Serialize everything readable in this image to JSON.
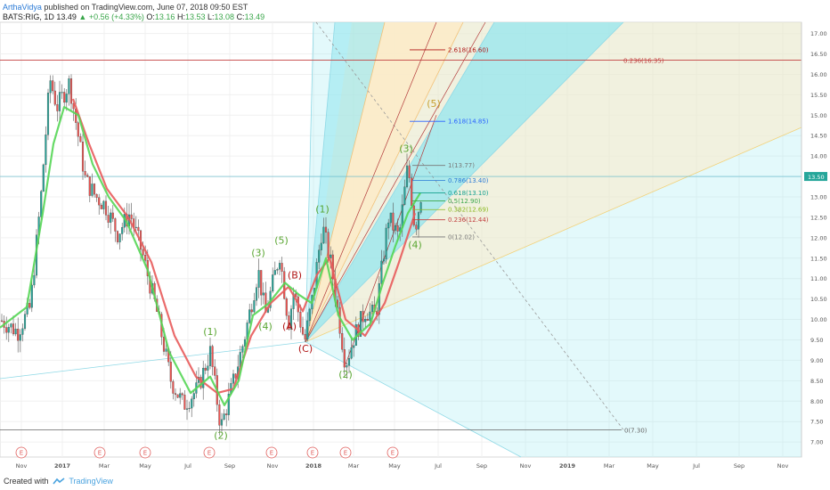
{
  "header": {
    "author": "ArthaVidya",
    "published": " published on TradingView.com, June 07, 2018 09:50 EST",
    "symbol": "BATS:RIG, 1D",
    "last": "13.49",
    "change": "▲ +0.56 (+4.33%)",
    "open_label": "O:",
    "open": "13.16",
    "high_label": "H:",
    "high": "13.53",
    "low_label": "L:",
    "low": "13.08",
    "close_label": "C:",
    "close": "13.49"
  },
  "footer": {
    "created_with": "Created with",
    "brand": "TradingView"
  },
  "colors": {
    "up": "#26a69a",
    "down": "#ef5350",
    "ma_fast": "#55d655",
    "ma_slow": "#e85b5b",
    "fan_cyan": "#8fe6ef",
    "fan_cream": "#fdebc8",
    "wave_green": "#5aa632",
    "wave_red": "#b01515",
    "price_tag": "#26a69a"
  },
  "chart_data": {
    "type": "candlestick",
    "symbol": "BATS:RIG",
    "interval": "1D",
    "ylim": [
      6.85,
      17.1
    ],
    "y_ticks": [
      "7.00",
      "7.50",
      "8.00",
      "8.50",
      "9.00",
      "9.50",
      "10.00",
      "10.50",
      "11.00",
      "11.50",
      "12.00",
      "12.50",
      "13.00",
      "13.50",
      "14.00",
      "14.50",
      "15.00",
      "15.50",
      "16.00",
      "16.50",
      "17.00"
    ],
    "x_ticks": [
      "Nov",
      "2017",
      "Mar",
      "May",
      "Jul",
      "Sep",
      "Nov",
      "2018",
      "Mar",
      "May",
      "Jul",
      "Sep",
      "Nov",
      "2019",
      "Mar",
      "May",
      "Jul",
      "Sep",
      "Nov"
    ],
    "last_price_tag": "13.50",
    "close_anchors": [
      {
        "x": 0,
        "y": 10.0
      },
      {
        "x": 20,
        "y": 9.7
      },
      {
        "x": 34,
        "y": 10.3
      },
      {
        "x": 46,
        "y": 13.0
      },
      {
        "x": 56,
        "y": 15.9
      },
      {
        "x": 64,
        "y": 15.2
      },
      {
        "x": 78,
        "y": 15.8
      },
      {
        "x": 96,
        "y": 13.4
      },
      {
        "x": 108,
        "y": 13.0
      },
      {
        "x": 118,
        "y": 12.8
      },
      {
        "x": 132,
        "y": 12.1
      },
      {
        "x": 146,
        "y": 12.6
      },
      {
        "x": 160,
        "y": 11.6
      },
      {
        "x": 176,
        "y": 10.2
      },
      {
        "x": 192,
        "y": 8.5
      },
      {
        "x": 206,
        "y": 7.9
      },
      {
        "x": 222,
        "y": 8.3
      },
      {
        "x": 236,
        "y": 9.2
      },
      {
        "x": 248,
        "y": 7.35
      },
      {
        "x": 260,
        "y": 8.3
      },
      {
        "x": 274,
        "y": 9.5
      },
      {
        "x": 290,
        "y": 11.2
      },
      {
        "x": 298,
        "y": 10.1
      },
      {
        "x": 314,
        "y": 11.6
      },
      {
        "x": 324,
        "y": 9.9
      },
      {
        "x": 330,
        "y": 10.7
      },
      {
        "x": 342,
        "y": 9.45
      },
      {
        "x": 350,
        "y": 10.4
      },
      {
        "x": 362,
        "y": 12.3
      },
      {
        "x": 372,
        "y": 11.3
      },
      {
        "x": 388,
        "y": 8.9
      },
      {
        "x": 398,
        "y": 9.6
      },
      {
        "x": 410,
        "y": 10.2
      },
      {
        "x": 422,
        "y": 10.1
      },
      {
        "x": 436,
        "y": 12.5
      },
      {
        "x": 448,
        "y": 12.0
      },
      {
        "x": 458,
        "y": 13.8
      },
      {
        "x": 466,
        "y": 12.2
      },
      {
        "x": 474,
        "y": 13.2
      }
    ],
    "ma_fast": [
      {
        "x": 0,
        "y": 9.8
      },
      {
        "x": 30,
        "y": 10.3
      },
      {
        "x": 48,
        "y": 12.6
      },
      {
        "x": 60,
        "y": 14.3
      },
      {
        "x": 72,
        "y": 15.2
      },
      {
        "x": 88,
        "y": 15.0
      },
      {
        "x": 104,
        "y": 13.8
      },
      {
        "x": 122,
        "y": 13.0
      },
      {
        "x": 142,
        "y": 12.4
      },
      {
        "x": 166,
        "y": 11.2
      },
      {
        "x": 190,
        "y": 9.2
      },
      {
        "x": 214,
        "y": 8.2
      },
      {
        "x": 236,
        "y": 8.6
      },
      {
        "x": 252,
        "y": 7.9
      },
      {
        "x": 268,
        "y": 8.5
      },
      {
        "x": 284,
        "y": 10.1
      },
      {
        "x": 302,
        "y": 10.4
      },
      {
        "x": 320,
        "y": 10.9
      },
      {
        "x": 336,
        "y": 10.6
      },
      {
        "x": 350,
        "y": 10.4
      },
      {
        "x": 366,
        "y": 11.5
      },
      {
        "x": 380,
        "y": 10.1
      },
      {
        "x": 396,
        "y": 9.5
      },
      {
        "x": 416,
        "y": 9.9
      },
      {
        "x": 430,
        "y": 10.9
      },
      {
        "x": 444,
        "y": 11.8
      },
      {
        "x": 458,
        "y": 12.6
      },
      {
        "x": 472,
        "y": 13.1
      }
    ],
    "ma_slow": [
      {
        "x": 82,
        "y": 15.4
      },
      {
        "x": 100,
        "y": 14.3
      },
      {
        "x": 120,
        "y": 13.2
      },
      {
        "x": 144,
        "y": 12.5
      },
      {
        "x": 170,
        "y": 11.4
      },
      {
        "x": 196,
        "y": 9.6
      },
      {
        "x": 220,
        "y": 8.6
      },
      {
        "x": 244,
        "y": 8.2
      },
      {
        "x": 262,
        "y": 8.3
      },
      {
        "x": 282,
        "y": 9.6
      },
      {
        "x": 304,
        "y": 10.4
      },
      {
        "x": 324,
        "y": 10.8
      },
      {
        "x": 340,
        "y": 10.2
      },
      {
        "x": 356,
        "y": 11.1
      },
      {
        "x": 370,
        "y": 11.5
      },
      {
        "x": 388,
        "y": 10.0
      },
      {
        "x": 410,
        "y": 9.6
      },
      {
        "x": 432,
        "y": 10.4
      },
      {
        "x": 448,
        "y": 11.4
      },
      {
        "x": 466,
        "y": 12.6
      }
    ],
    "horizontal_lines": [
      {
        "price": 16.35,
        "label": "0.236(16.35)",
        "color": "#c24040"
      },
      {
        "price": 13.5,
        "label": "",
        "color": "#5ab5c9"
      },
      {
        "price": 7.3,
        "label": "0(7.30)",
        "color": "#666666"
      }
    ],
    "fib_levels": [
      {
        "price": 16.6,
        "label": "2.618(16.60)",
        "color": "#b01515"
      },
      {
        "price": 14.85,
        "label": "1.618(14.85)",
        "color": "#2962ff"
      },
      {
        "price": 13.77,
        "label": "1(13.77)",
        "color": "#777777"
      },
      {
        "price": 13.4,
        "label": "0.786(13.40)",
        "color": "#2a7ad6"
      },
      {
        "price": 13.1,
        "label": "0.618(13.10)",
        "color": "#14a08f"
      },
      {
        "price": 12.9,
        "label": "0.5(12.90)",
        "color": "#3aa64a"
      },
      {
        "price": 12.69,
        "label": "0.382(12.69)",
        "color": "#8ab820"
      },
      {
        "price": 12.44,
        "label": "0.236(12.44)",
        "color": "#c24040"
      },
      {
        "price": 12.02,
        "label": "0(12.02)",
        "color": "#777777"
      }
    ],
    "wave_labels": [
      {
        "text": "(1)",
        "x": 236,
        "price": 9.62,
        "color": "green"
      },
      {
        "text": "(2)",
        "x": 248,
        "price": 7.08,
        "color": "green"
      },
      {
        "text": "(3)",
        "x": 290,
        "price": 11.55,
        "color": "green"
      },
      {
        "text": "(4)",
        "x": 298,
        "price": 9.75,
        "color": "green"
      },
      {
        "text": "(5)",
        "x": 316,
        "price": 11.85,
        "color": "green"
      },
      {
        "text": "(B)",
        "x": 331,
        "price": 11.0,
        "color": "red"
      },
      {
        "text": "(A)",
        "x": 325,
        "price": 9.75,
        "color": "red"
      },
      {
        "text": "(C)",
        "x": 343,
        "price": 9.2,
        "color": "red"
      },
      {
        "text": "(1)",
        "x": 362,
        "price": 12.62,
        "color": "green"
      },
      {
        "text": "(2)",
        "x": 388,
        "price": 8.57,
        "color": "green"
      },
      {
        "text": "(3)",
        "x": 456,
        "price": 14.1,
        "color": "green"
      },
      {
        "text": "(4)",
        "x": 466,
        "price": 11.75,
        "color": "green"
      },
      {
        "text": "(5)",
        "x": 487,
        "price": 15.2,
        "color": "olive"
      }
    ],
    "event_markers": [
      "E",
      "E",
      "E",
      "E",
      "E",
      "E",
      "E",
      "E",
      "E",
      "E"
    ]
  }
}
